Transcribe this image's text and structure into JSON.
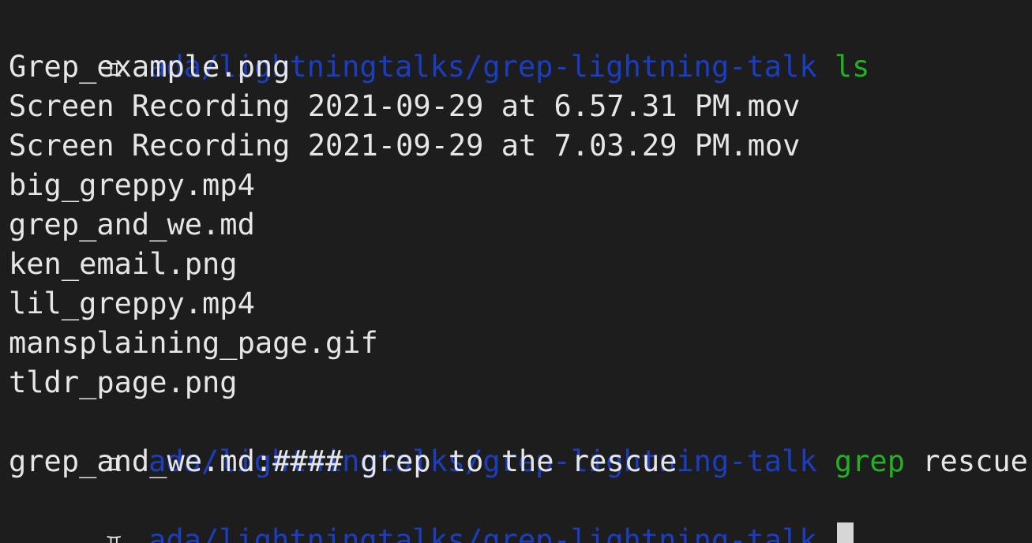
{
  "terminal": {
    "prompt_symbol": "♊",
    "colors": {
      "background": "#1d1d1d",
      "path": "#1b3ec0",
      "command": "#23b123",
      "text": "#e6e6e6"
    },
    "cmd1": {
      "path": "ada/lightningtalks/grep-lightning-talk",
      "command": "ls"
    },
    "ls_output": [
      "Grep_example.png",
      "Screen Recording 2021-09-29 at 6.57.31 PM.mov",
      "Screen Recording 2021-09-29 at 7.03.29 PM.mov",
      "big_greppy.mp4",
      "grep_and_we.md",
      "ken_email.png",
      "lil_greppy.mp4",
      "mansplaining_page.gif",
      "tldr_page.png"
    ],
    "cmd2": {
      "path": "ada/lightningtalks/grep-lightning-talk",
      "command": "grep",
      "argument": "rescue",
      "glob": "*"
    },
    "grep_output": "grep_and_we.md:#### grep to the rescue",
    "cmd3": {
      "path": "ada/lightningtalks/grep-lightning-talk"
    }
  }
}
